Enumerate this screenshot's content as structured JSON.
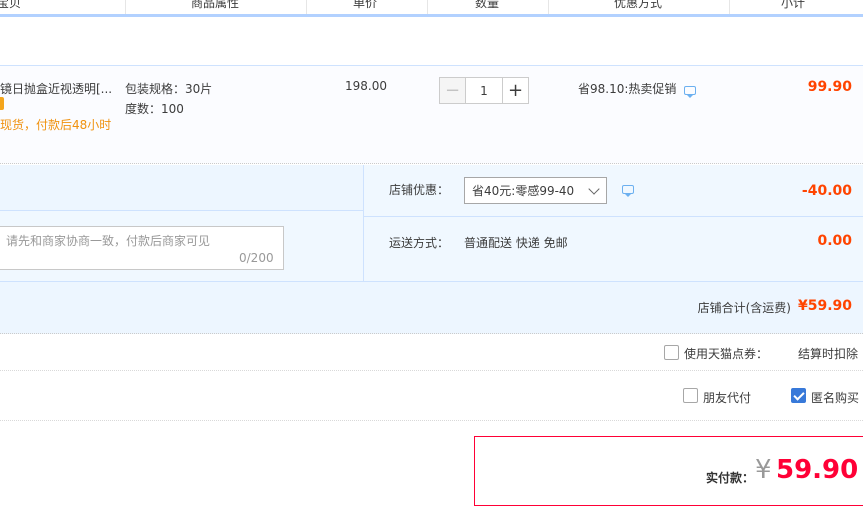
{
  "header": {
    "columns": [
      "宝贝",
      "商品属性",
      "单价",
      "数量",
      "优惠方式",
      "小计"
    ]
  },
  "item": {
    "title": "镜日抛盒近视透明[...",
    "stock_note": "现货，付款后48小时",
    "sku_spec": "包装规格：30片",
    "sku_degree": "度数：100",
    "unit_price": "198.00",
    "quantity": "1",
    "minus": "−",
    "plus": "+",
    "promo": "省98.10:热卖促销",
    "subtotal": "99.90"
  },
  "shop": {
    "discount_label": "店铺优惠：",
    "discount_selected": "省40元:零感99-40",
    "discount_value": "-40.00",
    "message_placeholder": "请先和商家协商一致，付款后商家可见",
    "message_count": "0/200",
    "shipping_label": "运送方式：",
    "shipping_method": "普通配送 快递 免邮",
    "shipping_value": "0.00",
    "total_label": "店铺合计(含运费)",
    "total_value": "¥59.90"
  },
  "options": {
    "coupon_label": "使用天猫点券：",
    "coupon_note": "结算时扣除",
    "friend_pay_label": "朋友代付",
    "anonymous_label": "匿名购买",
    "anonymous_checked": true
  },
  "payment": {
    "label": "实付款：",
    "currency": "¥",
    "amount": "59.90"
  },
  "colors": {
    "accent_red": "#ff0036",
    "price_red": "#ff4400",
    "blue_line": "#b2d1ff",
    "checkbox_blue": "#3879d9"
  }
}
